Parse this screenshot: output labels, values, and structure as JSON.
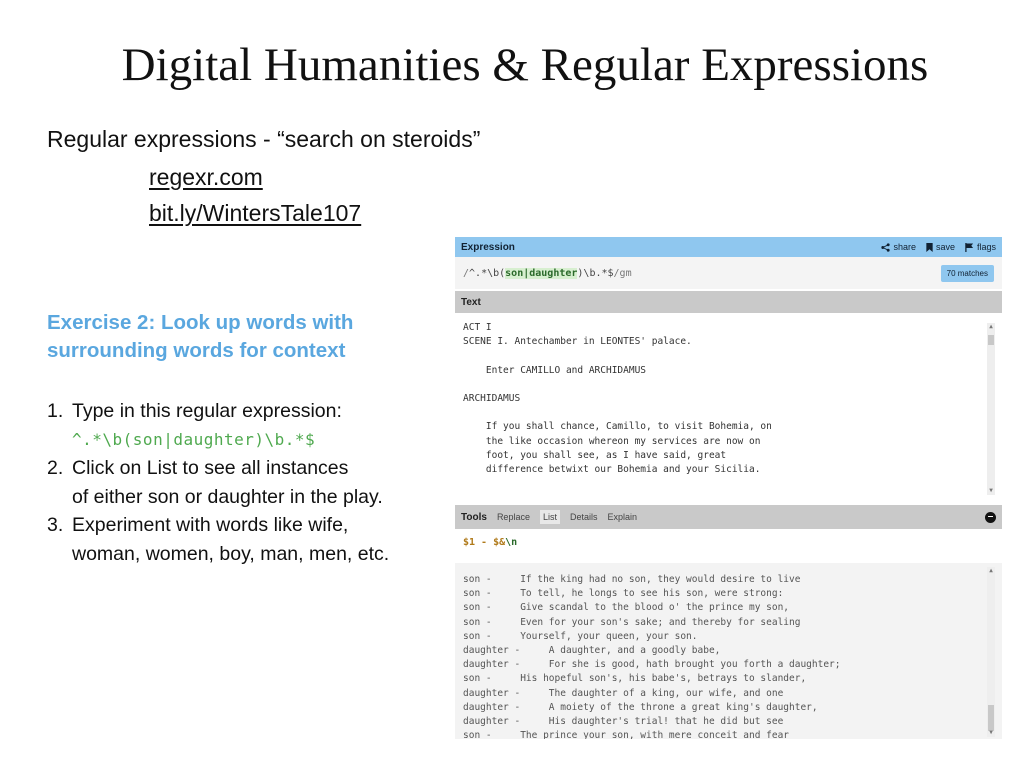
{
  "slide": {
    "title": "Digital Humanities & Regular Expressions",
    "subtitle": "Regular expressions - “search on steroids”",
    "links": [
      "regexr.com",
      "bit.ly/WintersTale107"
    ],
    "exercise_title_line1": "Exercise 2: Look up words with",
    "exercise_title_line2": "surrounding words for context",
    "steps": [
      {
        "num": "1.",
        "text": "Type in this regular expression:",
        "code": "^.*\\b(son|daughter)\\b.*$"
      },
      {
        "num": "2.",
        "line1": "Click on List to see all instances",
        "line2": "of either son or daughter in the play."
      },
      {
        "num": "3.",
        "line1": "Experiment with words like wife,",
        "line2": "woman, women, boy, man, men, etc."
      }
    ]
  },
  "regexr": {
    "expression_label": "Expression",
    "share_label": "share",
    "save_label": "save",
    "flags_label": "flags",
    "expr_open": "/",
    "expr_pre": "^.*\\b(",
    "expr_group": "son|daughter",
    "expr_post": ")\\b.*$",
    "expr_close": "/gm",
    "matches": "70 matches",
    "text_label": "Text",
    "text_lines": [
      "ACT I",
      "SCENE I. Antechamber in LEONTES' palace.",
      "",
      "    Enter CAMILLO and ARCHIDAMUS",
      "",
      "ARCHIDAMUS",
      "",
      "    If you shall chance, Camillo, to visit Bohemia, on",
      "    the like occasion whereon my services are now on",
      "    foot, you shall see, as I have said, great",
      "    difference betwixt our Bohemia and your Sicilia."
    ],
    "tools_label": "Tools",
    "tabs": [
      "Replace",
      "List",
      "Details",
      "Explain"
    ],
    "subst_pre": "$1 - $&",
    "subst_newline": "\\n",
    "list_lines": [
      "son -     If the king had no son, they would desire to live",
      "son -     To tell, he longs to see his son, were strong:",
      "son -     Give scandal to the blood o' the prince my son,",
      "son -     Even for your son's sake; and thereby for sealing",
      "son -     Yourself, your queen, your son.",
      "daughter -     A daughter, and a goodly babe,",
      "daughter -     For she is good, hath brought you forth a daughter;",
      "son -     His hopeful son's, his babe's, betrays to slander,",
      "daughter -     The daughter of a king, our wife, and one",
      "daughter -     A moiety of the throne a great king's daughter,",
      "daughter -     His daughter's trial! that he did but see",
      "son -     The prince your son, with mere conceit and fear"
    ]
  }
}
